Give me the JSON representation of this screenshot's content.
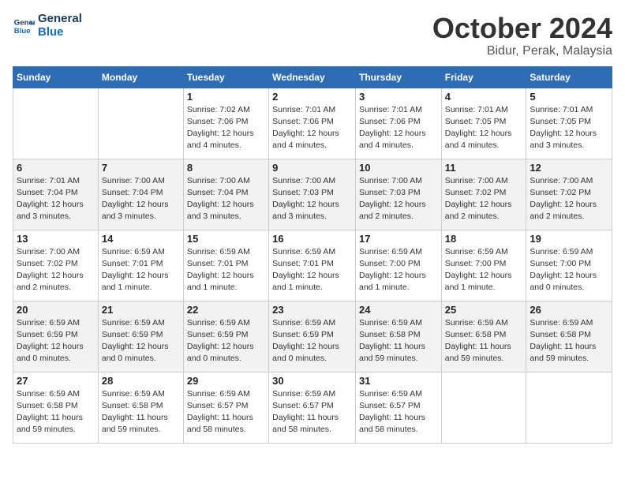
{
  "header": {
    "logo_line1": "General",
    "logo_line2": "Blue",
    "month": "October 2024",
    "location": "Bidur, Perak, Malaysia"
  },
  "columns": [
    "Sunday",
    "Monday",
    "Tuesday",
    "Wednesday",
    "Thursday",
    "Friday",
    "Saturday"
  ],
  "weeks": [
    [
      {
        "day": "",
        "detail": ""
      },
      {
        "day": "",
        "detail": ""
      },
      {
        "day": "1",
        "detail": "Sunrise: 7:02 AM\nSunset: 7:06 PM\nDaylight: 12 hours\nand 4 minutes."
      },
      {
        "day": "2",
        "detail": "Sunrise: 7:01 AM\nSunset: 7:06 PM\nDaylight: 12 hours\nand 4 minutes."
      },
      {
        "day": "3",
        "detail": "Sunrise: 7:01 AM\nSunset: 7:06 PM\nDaylight: 12 hours\nand 4 minutes."
      },
      {
        "day": "4",
        "detail": "Sunrise: 7:01 AM\nSunset: 7:05 PM\nDaylight: 12 hours\nand 4 minutes."
      },
      {
        "day": "5",
        "detail": "Sunrise: 7:01 AM\nSunset: 7:05 PM\nDaylight: 12 hours\nand 3 minutes."
      }
    ],
    [
      {
        "day": "6",
        "detail": "Sunrise: 7:01 AM\nSunset: 7:04 PM\nDaylight: 12 hours\nand 3 minutes."
      },
      {
        "day": "7",
        "detail": "Sunrise: 7:00 AM\nSunset: 7:04 PM\nDaylight: 12 hours\nand 3 minutes."
      },
      {
        "day": "8",
        "detail": "Sunrise: 7:00 AM\nSunset: 7:04 PM\nDaylight: 12 hours\nand 3 minutes."
      },
      {
        "day": "9",
        "detail": "Sunrise: 7:00 AM\nSunset: 7:03 PM\nDaylight: 12 hours\nand 3 minutes."
      },
      {
        "day": "10",
        "detail": "Sunrise: 7:00 AM\nSunset: 7:03 PM\nDaylight: 12 hours\nand 2 minutes."
      },
      {
        "day": "11",
        "detail": "Sunrise: 7:00 AM\nSunset: 7:02 PM\nDaylight: 12 hours\nand 2 minutes."
      },
      {
        "day": "12",
        "detail": "Sunrise: 7:00 AM\nSunset: 7:02 PM\nDaylight: 12 hours\nand 2 minutes."
      }
    ],
    [
      {
        "day": "13",
        "detail": "Sunrise: 7:00 AM\nSunset: 7:02 PM\nDaylight: 12 hours\nand 2 minutes."
      },
      {
        "day": "14",
        "detail": "Sunrise: 6:59 AM\nSunset: 7:01 PM\nDaylight: 12 hours\nand 1 minute."
      },
      {
        "day": "15",
        "detail": "Sunrise: 6:59 AM\nSunset: 7:01 PM\nDaylight: 12 hours\nand 1 minute."
      },
      {
        "day": "16",
        "detail": "Sunrise: 6:59 AM\nSunset: 7:01 PM\nDaylight: 12 hours\nand 1 minute."
      },
      {
        "day": "17",
        "detail": "Sunrise: 6:59 AM\nSunset: 7:00 PM\nDaylight: 12 hours\nand 1 minute."
      },
      {
        "day": "18",
        "detail": "Sunrise: 6:59 AM\nSunset: 7:00 PM\nDaylight: 12 hours\nand 1 minute."
      },
      {
        "day": "19",
        "detail": "Sunrise: 6:59 AM\nSunset: 7:00 PM\nDaylight: 12 hours\nand 0 minutes."
      }
    ],
    [
      {
        "day": "20",
        "detail": "Sunrise: 6:59 AM\nSunset: 6:59 PM\nDaylight: 12 hours\nand 0 minutes."
      },
      {
        "day": "21",
        "detail": "Sunrise: 6:59 AM\nSunset: 6:59 PM\nDaylight: 12 hours\nand 0 minutes."
      },
      {
        "day": "22",
        "detail": "Sunrise: 6:59 AM\nSunset: 6:59 PM\nDaylight: 12 hours\nand 0 minutes."
      },
      {
        "day": "23",
        "detail": "Sunrise: 6:59 AM\nSunset: 6:59 PM\nDaylight: 12 hours\nand 0 minutes."
      },
      {
        "day": "24",
        "detail": "Sunrise: 6:59 AM\nSunset: 6:58 PM\nDaylight: 11 hours\nand 59 minutes."
      },
      {
        "day": "25",
        "detail": "Sunrise: 6:59 AM\nSunset: 6:58 PM\nDaylight: 11 hours\nand 59 minutes."
      },
      {
        "day": "26",
        "detail": "Sunrise: 6:59 AM\nSunset: 6:58 PM\nDaylight: 11 hours\nand 59 minutes."
      }
    ],
    [
      {
        "day": "27",
        "detail": "Sunrise: 6:59 AM\nSunset: 6:58 PM\nDaylight: 11 hours\nand 59 minutes."
      },
      {
        "day": "28",
        "detail": "Sunrise: 6:59 AM\nSunset: 6:58 PM\nDaylight: 11 hours\nand 59 minutes."
      },
      {
        "day": "29",
        "detail": "Sunrise: 6:59 AM\nSunset: 6:57 PM\nDaylight: 11 hours\nand 58 minutes."
      },
      {
        "day": "30",
        "detail": "Sunrise: 6:59 AM\nSunset: 6:57 PM\nDaylight: 11 hours\nand 58 minutes."
      },
      {
        "day": "31",
        "detail": "Sunrise: 6:59 AM\nSunset: 6:57 PM\nDaylight: 11 hours\nand 58 minutes."
      },
      {
        "day": "",
        "detail": ""
      },
      {
        "day": "",
        "detail": ""
      }
    ]
  ]
}
